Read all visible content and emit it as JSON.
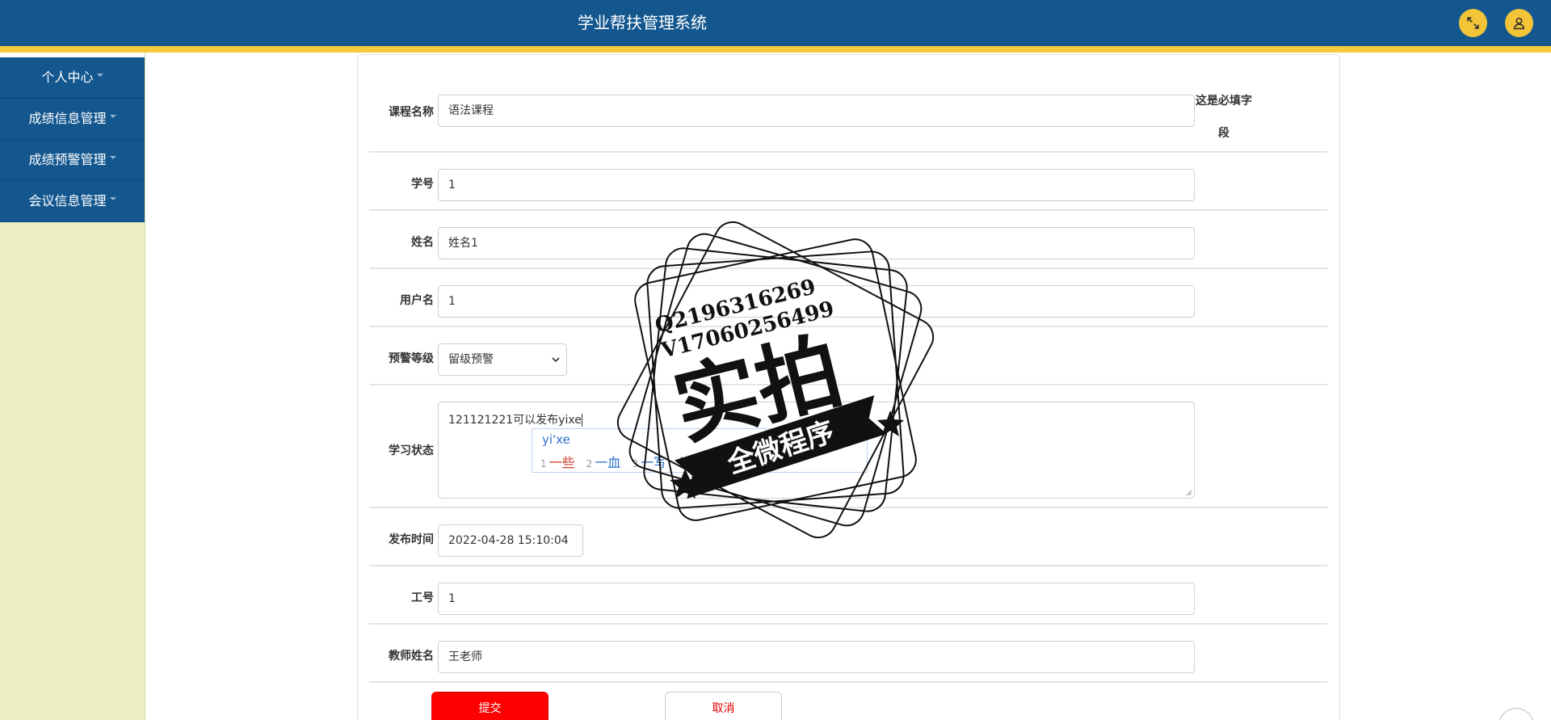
{
  "header": {
    "title": "学业帮扶管理系统"
  },
  "sidebar": {
    "items": [
      {
        "label": "个人中心"
      },
      {
        "label": "成绩信息管理"
      },
      {
        "label": "成绩预警管理"
      },
      {
        "label": "会议信息管理"
      }
    ]
  },
  "form": {
    "course_name": {
      "label": "课程名称",
      "value": "语法课程"
    },
    "required_hint": "这是必填字段",
    "student_id": {
      "label": "学号",
      "value": "1"
    },
    "name": {
      "label": "姓名",
      "value": "姓名1"
    },
    "username": {
      "label": "用户名",
      "value": "1"
    },
    "warning_level": {
      "label": "预警等级",
      "value": "留级预警"
    },
    "study_status": {
      "label": "学习状态",
      "value": "121121221可以发布yixe"
    },
    "publish_time": {
      "label": "发布时间",
      "value": "2022-04-28 15:10:04"
    },
    "staff_id": {
      "label": "工号",
      "value": "1"
    },
    "teacher_name": {
      "label": "教师姓名",
      "value": "王老师"
    },
    "submit_label": "提交",
    "cancel_label": "取消"
  },
  "ime": {
    "composition": "yi'xe",
    "candidates": [
      {
        "num": "1",
        "text": "一些"
      },
      {
        "num": "2",
        "text": "一血"
      },
      {
        "num": "3",
        "text": "一写"
      },
      {
        "num": "4",
        "text": ""
      }
    ]
  },
  "watermark": {
    "line1": "Q2196316269",
    "line2": "V17060256499",
    "big": "实拍",
    "banner": "全微程序"
  },
  "colors": {
    "header_bg": "#14578f",
    "header_stripe": "#f5c93a",
    "sidebar_bg": "#ecefc4",
    "header_button": "#f3c437",
    "submit": "#ff0000"
  }
}
